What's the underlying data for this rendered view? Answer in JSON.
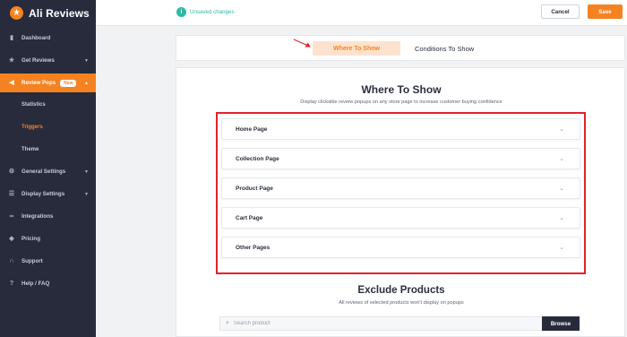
{
  "brand": {
    "name": "Ali Reviews",
    "logo_icon": "star-icon",
    "accent_color": "#f58220"
  },
  "sidebar": {
    "items": [
      {
        "label": "Dashboard",
        "icon": "bar-chart-icon"
      },
      {
        "label": "Get Reviews",
        "icon": "star-icon",
        "has_caret": true
      },
      {
        "label": "Review Pops",
        "icon": "megaphone-icon",
        "has_caret": true,
        "badge": "New",
        "active": true
      },
      {
        "label": "General Settings",
        "icon": "gear-icon",
        "has_caret": true
      },
      {
        "label": "Display Settings",
        "icon": "sliders-icon",
        "has_caret": true
      },
      {
        "label": "Integrations",
        "icon": "link-icon"
      },
      {
        "label": "Pricing",
        "icon": "tag-icon"
      },
      {
        "label": "Support",
        "icon": "headset-icon"
      },
      {
        "label": "Help / FAQ",
        "icon": "help-icon"
      }
    ],
    "subitems": [
      {
        "label": "Statistics"
      },
      {
        "label": "Triggers",
        "selected": true
      },
      {
        "label": "Theme"
      }
    ]
  },
  "topbar": {
    "status_text": "Unsaved changes",
    "status_icon": "info-icon",
    "cancel_label": "Cancel",
    "save_label": "Save"
  },
  "tabs": [
    {
      "label": "Where To Show",
      "active": true
    },
    {
      "label": "Conditions To Show",
      "active": false
    }
  ],
  "where_to_show": {
    "title": "Where To Show",
    "subtitle": "Display clickable review popups on any store page to increase customer buying confidence",
    "pages": [
      {
        "label": "Home Page"
      },
      {
        "label": "Collection Page"
      },
      {
        "label": "Product Page"
      },
      {
        "label": "Cart Page"
      },
      {
        "label": "Other Pages"
      }
    ]
  },
  "exclude_products": {
    "title": "Exclude Products",
    "subtitle": "All reviews of selected products won't display on popups",
    "search_placeholder": "Search product",
    "browse_label": "Browse"
  }
}
